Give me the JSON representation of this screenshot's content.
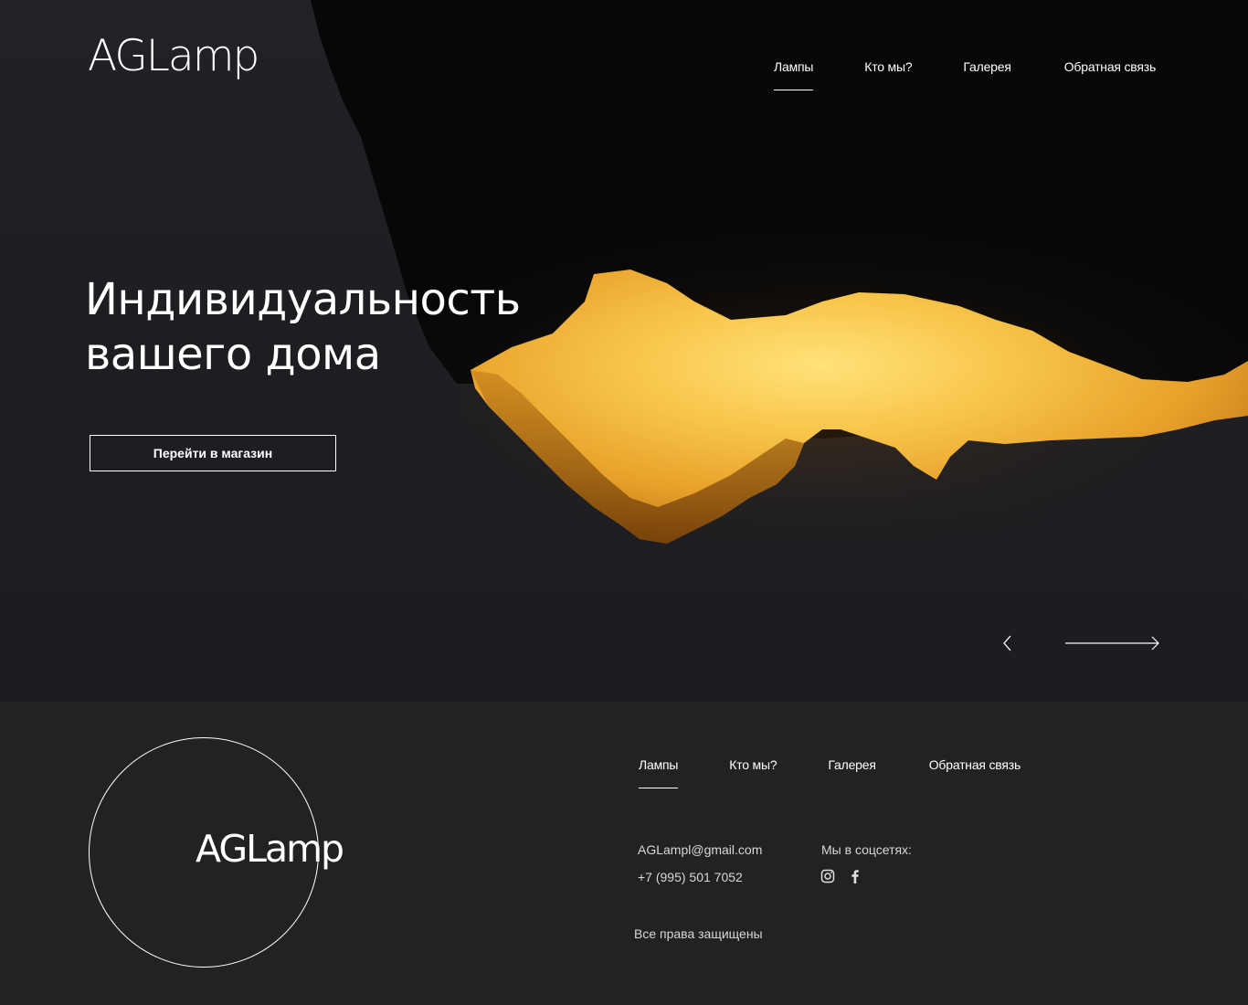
{
  "brand": {
    "logo": "AGLamp"
  },
  "header": {
    "nav": [
      {
        "label": "Лампы",
        "active": true
      },
      {
        "label": "Кто мы?",
        "active": false
      },
      {
        "label": "Галерея",
        "active": false
      },
      {
        "label": "Обратная связь",
        "active": false
      }
    ]
  },
  "hero": {
    "headline_line1": "Индивидуальность",
    "headline_line2": "вашего дома",
    "cta_label": "Перейти в магазин",
    "prev_icon": "chevron-left-icon",
    "next_icon": "long-arrow-right-icon"
  },
  "footer": {
    "logo": "AGLamp",
    "nav": [
      {
        "label": "Лампы",
        "active": true
      },
      {
        "label": "Кто мы?",
        "active": false
      },
      {
        "label": "Галерея",
        "active": false
      },
      {
        "label": "Обратная связь",
        "active": false
      }
    ],
    "email": "AGLampl@gmail.com",
    "phone": "+7 (995) 501 7052",
    "social_label": "Мы в соцсетях:",
    "social_icons": [
      "instagram-icon",
      "facebook-icon"
    ],
    "rights": "Все права защищены"
  },
  "colors": {
    "background": "#222222",
    "hero_dark": "#1d1d21",
    "glow_gold": "#f5b332",
    "text": "#ffffff"
  }
}
